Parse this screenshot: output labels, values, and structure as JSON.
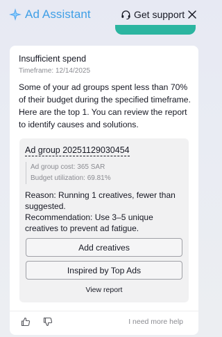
{
  "header": {
    "app_title": "Ad Assistant",
    "support_label": "Get support"
  },
  "card": {
    "title": "Insufficient spend",
    "timeframe": "Timeframe: 12/14/2025",
    "message": "Some of your ad groups spent less than 70% of their budget during the specified timeframe. Here are the top 1. You can review the report to identify causes and solutions.",
    "ad_group": {
      "name": "Ad group 20251129030454",
      "cost": "Ad group cost: 365 SAR",
      "utilization": "Budget utilization: 69.81%",
      "reason": "Reason: Running 1 creatives, fewer than suggested.",
      "recommendation": "Recommendation: Use 3–5 unique creatives to prevent ad fatigue.",
      "add_creatives_label": "Add creatives",
      "inspired_label": "Inspired by Top Ads",
      "view_report_label": "View report"
    },
    "footer": {
      "help_label": "I need more help"
    }
  },
  "colors": {
    "brand": "#3f9fe6",
    "accent_teal": "#2bb5a0"
  }
}
